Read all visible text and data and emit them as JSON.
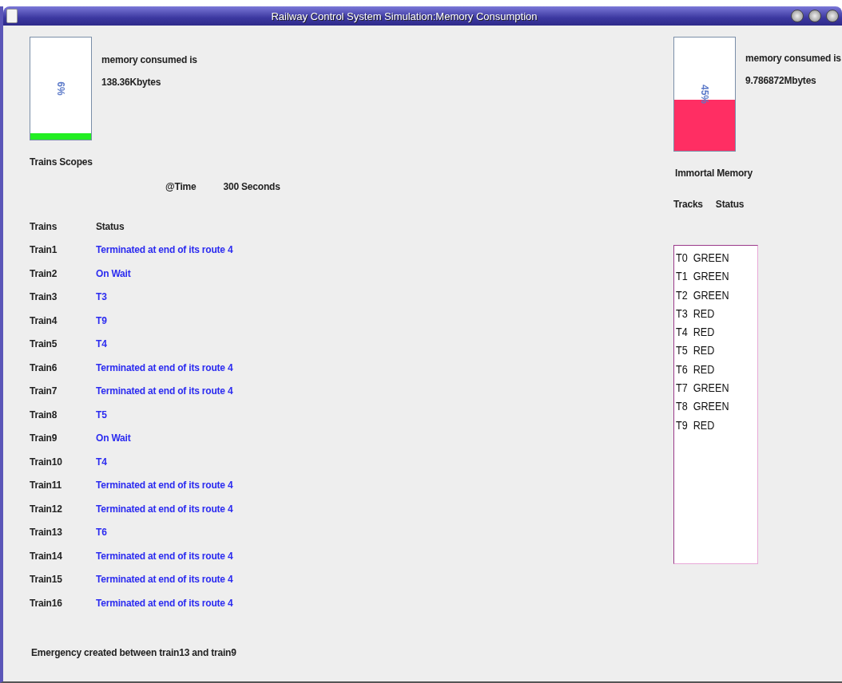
{
  "window": {
    "title": "Railway Control System Simulation:Memory Consumption"
  },
  "scoped_memory": {
    "level": 0.06,
    "percent": "6%",
    "label": "memory consumed is",
    "amount": "138.36Kbytes",
    "color": "#22ee22"
  },
  "immortal_memory": {
    "level": 0.45,
    "percent": "45%",
    "label": "memory consumed is",
    "amount": "9.786872Mbytes",
    "color": "#ff2e63",
    "title": "Immortal Memory"
  },
  "trains_title": "Trains Scopes",
  "time_label": "@Time",
  "time_value": "300 Seconds",
  "trains_table": {
    "columns": [
      "Trains",
      "Status"
    ],
    "rows": [
      {
        "train": "Train1",
        "status": "Terminated at end of its route 4"
      },
      {
        "train": "Train2",
        "status": "On Wait"
      },
      {
        "train": "Train3",
        "status": "T3"
      },
      {
        "train": "Train4",
        "status": "T9"
      },
      {
        "train": "Train5",
        "status": "T4"
      },
      {
        "train": "Train6",
        "status": "Terminated at end of its route 4"
      },
      {
        "train": "Train7",
        "status": "Terminated at end of its route 4"
      },
      {
        "train": "Train8",
        "status": "T5"
      },
      {
        "train": "Train9",
        "status": "On Wait"
      },
      {
        "train": "Train10",
        "status": "T4"
      },
      {
        "train": "Train11",
        "status": "Terminated at end of its route 4"
      },
      {
        "train": "Train12",
        "status": "Terminated at end of its route 4"
      },
      {
        "train": "Train13",
        "status": "T6"
      },
      {
        "train": "Train14",
        "status": "Terminated at end of its route 4"
      },
      {
        "train": "Train15",
        "status": "Terminated at end of its route 4"
      },
      {
        "train": "Train16",
        "status": "Terminated at end of its route 4"
      }
    ]
  },
  "tracks_columns": [
    "Tracks",
    "Status"
  ],
  "tracks": [
    "T0  GREEN",
    "T1  GREEN",
    "T2  GREEN",
    "T3  RED",
    "T4  RED",
    "T5  RED",
    "T6  RED",
    "T7  GREEN",
    "T8  GREEN",
    "T9  RED"
  ],
  "message": "Emergency created between  train13 and train9"
}
